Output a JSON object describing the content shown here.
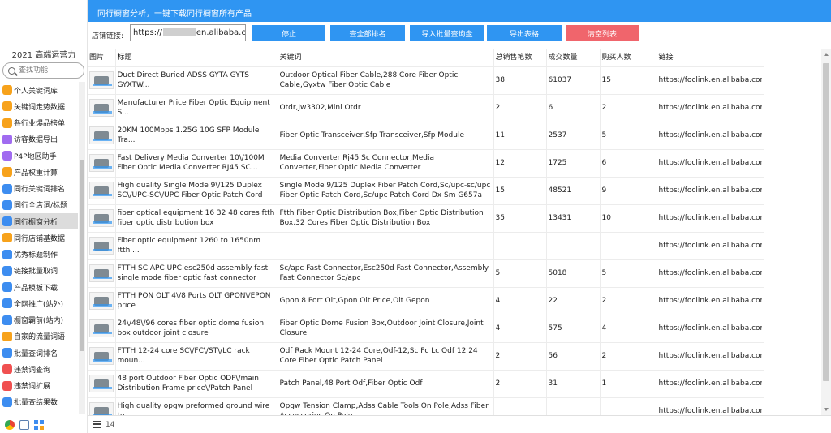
{
  "header": {
    "title": "同行橱窗分析，一键下载同行橱窗所有产品"
  },
  "sidebar": {
    "brand": "2021 高端运营力",
    "search_placeholder": "查找功能",
    "items": [
      {
        "label": "个人关键词库",
        "color": "#f7a21b",
        "icon": "folder-icon"
      },
      {
        "label": "关键词走势数据",
        "color": "#f7a21b",
        "icon": "chart-icon"
      },
      {
        "label": "各行业爆品榜单",
        "color": "#f7a21b",
        "icon": "list-icon"
      },
      {
        "label": "访客数据导出",
        "color": "#a06bf0",
        "icon": "export-icon"
      },
      {
        "label": "P4P地区助手",
        "color": "#a06bf0",
        "icon": "map-icon"
      },
      {
        "label": "产品权重计算",
        "color": "#f7a21b",
        "icon": "calc-icon"
      },
      {
        "label": "同行关键词排名",
        "color": "#3d8df0",
        "icon": "rank-icon"
      },
      {
        "label": "同行全店词/标题",
        "color": "#3d8df0",
        "icon": "store-icon"
      },
      {
        "label": "同行橱窗分析",
        "color": "#3d8df0",
        "icon": "window-icon"
      },
      {
        "label": "同行店铺基数据",
        "color": "#f7a21b",
        "icon": "data-icon"
      },
      {
        "label": "优秀标题制作",
        "color": "#3d8df0",
        "icon": "title-icon"
      },
      {
        "label": "链接批量取词",
        "color": "#3d8df0",
        "icon": "link-icon"
      },
      {
        "label": "产品模板下载",
        "color": "#3d8df0",
        "icon": "download-icon"
      },
      {
        "label": "全网推广(站外)",
        "color": "#3d8df0",
        "icon": "globe-icon"
      },
      {
        "label": "橱窗霸前(站内)",
        "color": "#3d8df0",
        "icon": "crown-icon"
      },
      {
        "label": "自家的流量词语",
        "color": "#f7a21b",
        "icon": "traffic-icon"
      },
      {
        "label": "批量查词排名",
        "color": "#3d8df0",
        "icon": "search-rank-icon"
      },
      {
        "label": "违禁词查询",
        "color": "#f05050",
        "icon": "ban-icon"
      },
      {
        "label": "违禁词扩展",
        "color": "#f05050",
        "icon": "ban-expand-icon"
      },
      {
        "label": "批量查结果数",
        "color": "#3d8df0",
        "icon": "result-icon"
      }
    ]
  },
  "toolbar": {
    "url_label": "店铺链接:",
    "url_prefix": "https://",
    "url_suffix": "en.alibaba.com",
    "btn_stop": "停止",
    "btn_check_rank": "查全部排名",
    "btn_import": "导入批量查询盘",
    "btn_export": "导出表格",
    "btn_clear": "清空列表"
  },
  "table": {
    "headers": [
      "图片",
      "标题",
      "关键词",
      "总销售笔数",
      "成交数量",
      "购买人数",
      "链接"
    ],
    "rows": [
      {
        "title": "Duct Direct Buried ADSS GYTA GYTS GYXTW...",
        "keywords": "Outdoor Optical Fiber Cable,288 Core Fiber Optic Cable,Gyxtw Fiber Optic Cable",
        "sales": "38",
        "qty": "61037",
        "buyers": "15",
        "link": "https://foclink.en.alibaba.com"
      },
      {
        "title": "Manufacturer Price Fiber Optic Equipment S...",
        "keywords": "Otdr,Jw3302,Mini Otdr",
        "sales": "2",
        "qty": "6",
        "buyers": "2",
        "link": "https://foclink.en.alibaba.com"
      },
      {
        "title": "20KM 100Mbps 1.25G 10G SFP Module Tra...",
        "keywords": "Fiber Optic Transceiver,Sfp Transceiver,Sfp Module",
        "sales": "11",
        "qty": "2537",
        "buyers": "5",
        "link": "https://foclink.en.alibaba.com"
      },
      {
        "title": "Fast Delivery Media Converter 10\\/100M Fiber Optic Media Converter RJ45 SC Connector",
        "keywords": "Media Converter Rj45 Sc Connector,Media Converter,Fiber Optic Media Converter",
        "sales": "12",
        "qty": "1725",
        "buyers": "6",
        "link": "https://foclink.en.alibaba.com"
      },
      {
        "title": "High quality Single Mode 9\\/125 Duplex SC\\/UPC-SC\\/UPC Fiber Optic Patch Cord",
        "keywords": "Single Mode 9/125 Duplex Fiber Patch Cord,Sc/upc-sc/upc Fiber Optic Patch Cord,Sc/upc Patch Cord Dx Sm G657a",
        "sales": "15",
        "qty": "48521",
        "buyers": "9",
        "link": "https://foclink.en.alibaba.com"
      },
      {
        "title": "fiber optical equipment 16 32 48 cores ftth fiber optic distribution box",
        "keywords": "Ftth Fiber Optic Distribution Box,Fiber Optic Distribution Box,32 Cores Fiber Optic Distribution Box",
        "sales": "35",
        "qty": "13431",
        "buyers": "10",
        "link": "https://foclink.en.alibaba.com"
      },
      {
        "title": "Fiber optic equipment 1260 to 1650nm ftth ...",
        "keywords": "",
        "sales": "",
        "qty": "",
        "buyers": "",
        "link": "https://foclink.en.alibaba.com"
      },
      {
        "title": "FTTH SC APC UPC esc250d assembly fast single mode fiber optic fast connector",
        "keywords": "Sc/apc Fast Connector,Esc250d Fast Connector,Assembly Fast Connector Sc/apc",
        "sales": "5",
        "qty": "5018",
        "buyers": "5",
        "link": "https://foclink.en.alibaba.com"
      },
      {
        "title": "FTTH PON OLT 4\\/8 Ports OLT GPON\\/EPON price",
        "keywords": "Gpon 8 Port Olt,Gpon Olt Price,Olt Gepon",
        "sales": "4",
        "qty": "22",
        "buyers": "2",
        "link": "https://foclink.en.alibaba.com"
      },
      {
        "title": "24\\/48\\/96 cores fiber optic dome fusion box outdoor joint closure",
        "keywords": "Fiber Optic Dome Fusion Box,Outdoor Joint Closure,Joint Closure",
        "sales": "4",
        "qty": "575",
        "buyers": "4",
        "link": "https://foclink.en.alibaba.com"
      },
      {
        "title": "FTTH 12-24 core SC\\/FC\\/ST\\/LC rack moun...",
        "keywords": "Odf Rack Mount 12-24 Core,Odf-12,Sc Fc Lc Odf 12 24 Core Fiber Optic Patch Panel",
        "sales": "2",
        "qty": "56",
        "buyers": "2",
        "link": "https://foclink.en.alibaba.com"
      },
      {
        "title": "48 port Outdoor Fiber Optic ODF\\/main Distribution Frame price\\/Patch Panel",
        "keywords": "Patch Panel,48 Port Odf,Fiber Optic Odf",
        "sales": "2",
        "qty": "31",
        "buyers": "1",
        "link": "https://foclink.en.alibaba.com"
      },
      {
        "title": "High quality opgw preformed ground wire te...",
        "keywords": "Opgw Tension Clamp,Adss Cable Tools On Pole,Adss Fiber Accessories On Pole",
        "sales": "",
        "qty": "",
        "buyers": "",
        "link": "https://foclink.en.alibaba.com"
      }
    ]
  },
  "footer": {
    "count": "14"
  }
}
